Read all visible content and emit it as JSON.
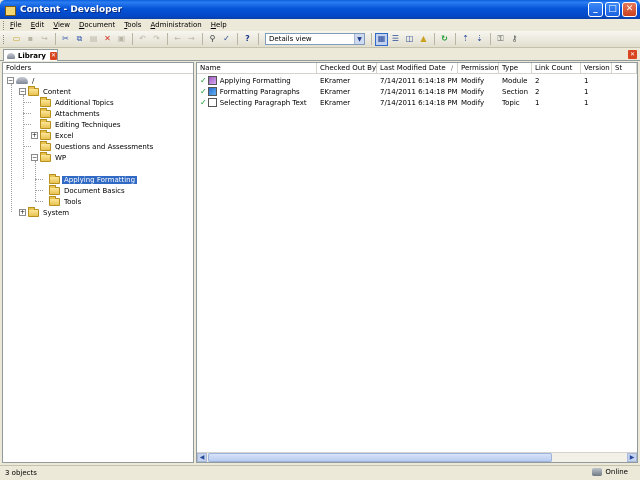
{
  "window": {
    "title": "Content - Developer"
  },
  "menu": [
    "File",
    "Edit",
    "View",
    "Document",
    "Tools",
    "Administration",
    "Help"
  ],
  "toolbar": {
    "view_select": "Details view"
  },
  "tab": {
    "label": "Library"
  },
  "folders": {
    "header": "Folders",
    "tree": [
      {
        "label": "/",
        "depth": 0,
        "expanded": true,
        "icon": "root-icon"
      },
      {
        "label": "Content",
        "depth": 1,
        "expanded": true,
        "icon": "folder-icon"
      },
      {
        "label": "Additional Topics",
        "depth": 2,
        "icon": "folder-icon"
      },
      {
        "label": "Attachments",
        "depth": 2,
        "icon": "folder-icon"
      },
      {
        "label": "Editing Techniques",
        "depth": 2,
        "icon": "folder-icon"
      },
      {
        "label": "Excel",
        "depth": 2,
        "expanded": false,
        "icon": "folder-icon"
      },
      {
        "label": "Questions and Assessments",
        "depth": 2,
        "icon": "folder-icon"
      },
      {
        "label": "WP",
        "depth": 2,
        "expanded": true,
        "icon": "folder-icon"
      },
      {
        "label": "Applying Formatting",
        "depth": 3,
        "selected": true,
        "icon": "folder-icon"
      },
      {
        "label": "Document Basics",
        "depth": 3,
        "icon": "folder-icon"
      },
      {
        "label": "Tools",
        "depth": 3,
        "icon": "folder-icon"
      },
      {
        "label": "System",
        "depth": 1,
        "expanded": false,
        "icon": "folder-icon"
      }
    ]
  },
  "list": {
    "columns": [
      "Name",
      "Checked Out By",
      "Last Modified Date",
      "Permission",
      "Type",
      "Link Count",
      "Version",
      "St"
    ],
    "rows": [
      {
        "name": "Applying Formatting",
        "checked_out_by": "EKramer",
        "modified": "7/14/2011 6:14:18 PM",
        "permission": "Modify",
        "type": "Module",
        "link_count": "2",
        "version": "1",
        "icon": "module"
      },
      {
        "name": "Formatting Paragraphs",
        "checked_out_by": "EKramer",
        "modified": "7/14/2011 6:14:18 PM",
        "permission": "Modify",
        "type": "Section",
        "link_count": "2",
        "version": "1",
        "icon": "section"
      },
      {
        "name": "Selecting Paragraph Text",
        "checked_out_by": "EKramer",
        "modified": "7/14/2011 6:14:18 PM",
        "permission": "Modify",
        "type": "Topic",
        "link_count": "1",
        "version": "1",
        "icon": "topic"
      }
    ]
  },
  "status": {
    "left": "3 objects",
    "right": "Online"
  }
}
